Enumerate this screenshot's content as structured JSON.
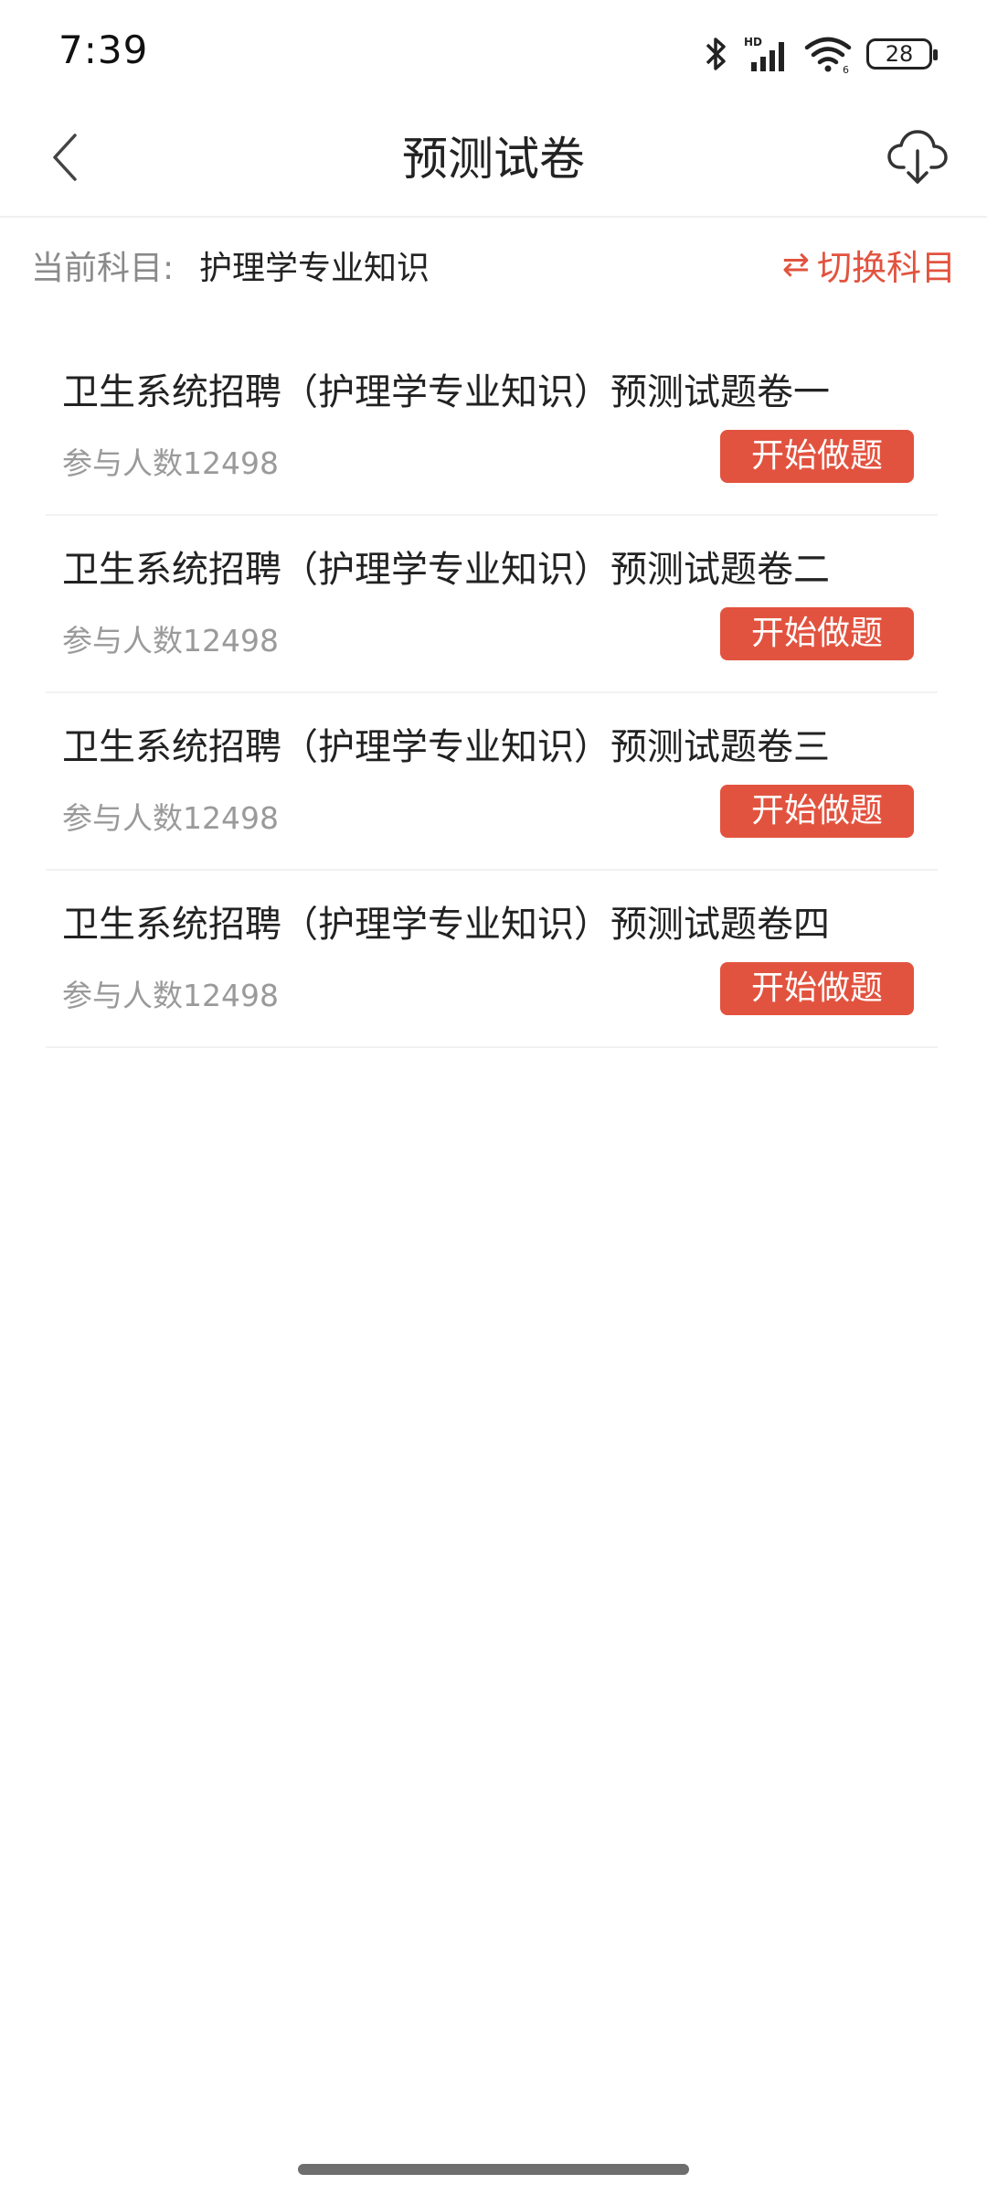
{
  "status": {
    "time": "7:39",
    "battery": "28",
    "icons": [
      "bluetooth-icon",
      "hd-signal-icon",
      "wifi-icon",
      "battery-icon"
    ]
  },
  "header": {
    "title": "预测试卷",
    "back_icon": "chevron-left-icon",
    "download_icon": "cloud-download-icon"
  },
  "subject": {
    "label": "当前科目:",
    "value": "护理学专业知识",
    "switch_icon": "⇄",
    "switch_label": "切换科目"
  },
  "papers": [
    {
      "title": "卫生系统招聘（护理学专业知识）预测试题卷一",
      "count": "参与人数12498",
      "button": "开始做题"
    },
    {
      "title": "卫生系统招聘（护理学专业知识）预测试题卷二",
      "count": "参与人数12498",
      "button": "开始做题"
    },
    {
      "title": "卫生系统招聘（护理学专业知识）预测试题卷三",
      "count": "参与人数12498",
      "button": "开始做题"
    },
    {
      "title": "卫生系统招聘（护理学专业知识）预测试题卷四",
      "count": "参与人数12498",
      "button": "开始做题"
    }
  ],
  "colors": {
    "accent": "#e2533f",
    "text_primary": "#222222",
    "text_secondary": "#9a9a9a"
  }
}
